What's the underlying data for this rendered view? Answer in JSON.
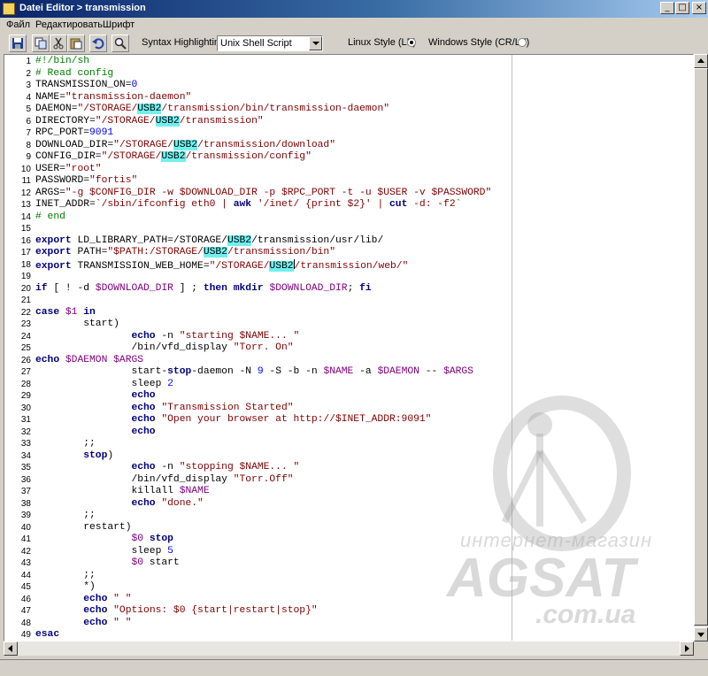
{
  "window": {
    "title": "Datei Editor > transmission",
    "minimize": "_",
    "maximize": "□",
    "close": "×"
  },
  "menu": {
    "items": [
      "Файл",
      "Редактировать",
      "Шрифт"
    ]
  },
  "toolbar": {
    "syntax_label": "Syntax Highlighting:",
    "syntax_value": "Unix Shell Script",
    "linux_style": "Linux Style (LF)",
    "windows_style": "Windows Style (CR/LF)",
    "selected_line_ending": "Linux Style (LF)"
  },
  "colors": {
    "keyword": "#000080",
    "string": "#800000",
    "comment": "#008000",
    "variable": "#800080",
    "number": "#0000ff",
    "highlight": "#6ff0f0"
  },
  "watermark": {
    "line1": "интернет-магазин",
    "line2": "AGSAT",
    "line3": ".com.ua"
  },
  "code": [
    {
      "n": "1",
      "t": [
        [
          "c",
          "#!/bin/sh"
        ]
      ]
    },
    {
      "n": "2",
      "t": [
        [
          "c",
          "# Read config"
        ]
      ]
    },
    {
      "n": "3",
      "t": [
        [
          "p",
          "TRANSMISSION_ON="
        ],
        [
          "n",
          "0"
        ]
      ]
    },
    {
      "n": "4",
      "t": [
        [
          "p",
          "NAME="
        ],
        [
          "s",
          "\"transmission-daemon\""
        ]
      ]
    },
    {
      "n": "5",
      "t": [
        [
          "p",
          "DAEMON="
        ],
        [
          "s",
          "\"/STORAGE/"
        ],
        [
          "h",
          "USB2"
        ],
        [
          "s",
          "/transmission/bin/transmission-daemon\""
        ]
      ]
    },
    {
      "n": "6",
      "t": [
        [
          "p",
          "DIRECTORY="
        ],
        [
          "s",
          "\"/STORAGE/"
        ],
        [
          "h",
          "USB2"
        ],
        [
          "s",
          "/transmission\""
        ]
      ]
    },
    {
      "n": "7",
      "t": [
        [
          "p",
          "RPC_PORT="
        ],
        [
          "n",
          "9091"
        ]
      ]
    },
    {
      "n": "8",
      "t": [
        [
          "p",
          "DOWNLOAD_DIR="
        ],
        [
          "s",
          "\"/STORAGE/"
        ],
        [
          "h",
          "USB2"
        ],
        [
          "s",
          "/transmission/download\""
        ]
      ]
    },
    {
      "n": "9",
      "t": [
        [
          "p",
          "CONFIG_DIR="
        ],
        [
          "s",
          "\"/STORAGE/"
        ],
        [
          "h",
          "USB2"
        ],
        [
          "s",
          "/transmission/config\""
        ]
      ]
    },
    {
      "n": "10",
      "t": [
        [
          "p",
          "USER="
        ],
        [
          "s",
          "\"root\""
        ]
      ]
    },
    {
      "n": "11",
      "t": [
        [
          "p",
          "PASSWORD="
        ],
        [
          "s",
          "\"fortis\""
        ]
      ]
    },
    {
      "n": "12",
      "t": [
        [
          "p",
          "ARGS="
        ],
        [
          "s",
          "\"-g $CONFIG_DIR -w $DOWNLOAD_DIR -p $RPC_PORT -t -u $USER -v $PASSWORD\""
        ]
      ]
    },
    {
      "n": "13",
      "t": [
        [
          "p",
          "INET_ADDR="
        ],
        [
          "s",
          "`/sbin/ifconfig eth0 | "
        ],
        [
          "k",
          "awk"
        ],
        [
          "s",
          " '/inet/ {print $2}' | "
        ],
        [
          "k",
          "cut"
        ],
        [
          "s",
          " -d: -f2`"
        ]
      ]
    },
    {
      "n": "14",
      "t": [
        [
          "c",
          "# end"
        ]
      ]
    },
    {
      "n": "15",
      "t": []
    },
    {
      "n": "16",
      "t": [
        [
          "k",
          "export"
        ],
        [
          "p",
          " LD_LIBRARY_PATH=/STORAGE/"
        ],
        [
          "h",
          "USB2"
        ],
        [
          "p",
          "/transmission/usr/lib/"
        ]
      ]
    },
    {
      "n": "17",
      "t": [
        [
          "k",
          "export"
        ],
        [
          "p",
          " PATH="
        ],
        [
          "s",
          "\"$PATH:/STORAGE/"
        ],
        [
          "h",
          "USB2"
        ],
        [
          "s",
          "/transmission/bin\""
        ]
      ]
    },
    {
      "n": "18",
      "t": [
        [
          "k",
          "export"
        ],
        [
          "p",
          " TRANSMISSION_WEB_HOME="
        ],
        [
          "s",
          "\"/STORAGE/"
        ],
        [
          "h",
          "USB2"
        ],
        [
          "cur",
          ""
        ],
        [
          "s",
          "/transmission/web/\""
        ]
      ]
    },
    {
      "n": "19",
      "t": []
    },
    {
      "n": "20",
      "t": [
        [
          "k",
          "if"
        ],
        [
          "p",
          " [ ! -d "
        ],
        [
          "v",
          "$DOWNLOAD_DIR"
        ],
        [
          "p",
          " ] ; "
        ],
        [
          "k",
          "then"
        ],
        [
          "p",
          " "
        ],
        [
          "k",
          "mkdir"
        ],
        [
          "p",
          " "
        ],
        [
          "v",
          "$DOWNLOAD_DIR"
        ],
        [
          "p",
          "; "
        ],
        [
          "k",
          "fi"
        ]
      ]
    },
    {
      "n": "21",
      "t": []
    },
    {
      "n": "22",
      "t": [
        [
          "k",
          "case"
        ],
        [
          "p",
          " "
        ],
        [
          "v",
          "$1"
        ],
        [
          "p",
          " "
        ],
        [
          "k",
          "in"
        ]
      ]
    },
    {
      "n": "23",
      "t": [
        [
          "p",
          "        start)"
        ]
      ]
    },
    {
      "n": "24",
      "t": [
        [
          "p",
          "                "
        ],
        [
          "k",
          "echo"
        ],
        [
          "p",
          " -n "
        ],
        [
          "s",
          "\"starting $NAME... \""
        ]
      ]
    },
    {
      "n": "25",
      "t": [
        [
          "p",
          "                /bin/vfd_display "
        ],
        [
          "s",
          "\"Torr. On\""
        ]
      ]
    },
    {
      "n": "26",
      "t": [
        [
          "k",
          "echo"
        ],
        [
          "p",
          " "
        ],
        [
          "v",
          "$DAEMON"
        ],
        [
          "p",
          " "
        ],
        [
          "v",
          "$ARGS"
        ]
      ]
    },
    {
      "n": "27",
      "t": [
        [
          "p",
          "                start-"
        ],
        [
          "k",
          "stop"
        ],
        [
          "p",
          "-daemon -N "
        ],
        [
          "n",
          "9"
        ],
        [
          "p",
          " -S -b -n "
        ],
        [
          "v",
          "$NAME"
        ],
        [
          "p",
          " -a "
        ],
        [
          "v",
          "$DAEMON"
        ],
        [
          "p",
          " -- "
        ],
        [
          "v",
          "$ARGS"
        ]
      ]
    },
    {
      "n": "28",
      "t": [
        [
          "p",
          "                sleep "
        ],
        [
          "n",
          "2"
        ]
      ]
    },
    {
      "n": "29",
      "t": [
        [
          "p",
          "                "
        ],
        [
          "k",
          "echo"
        ]
      ]
    },
    {
      "n": "30",
      "t": [
        [
          "p",
          "                "
        ],
        [
          "k",
          "echo"
        ],
        [
          "p",
          " "
        ],
        [
          "s",
          "\"Transmission Started\""
        ]
      ]
    },
    {
      "n": "31",
      "t": [
        [
          "p",
          "                "
        ],
        [
          "k",
          "echo"
        ],
        [
          "p",
          " "
        ],
        [
          "s",
          "\"Open your browser at http://$INET_ADDR:9091\""
        ]
      ]
    },
    {
      "n": "32",
      "t": [
        [
          "p",
          "                "
        ],
        [
          "k",
          "echo"
        ]
      ]
    },
    {
      "n": "33",
      "t": [
        [
          "p",
          "        ;;"
        ]
      ]
    },
    {
      "n": "34",
      "t": [
        [
          "p",
          "        "
        ],
        [
          "k",
          "stop"
        ],
        [
          "p",
          ")"
        ]
      ]
    },
    {
      "n": "35",
      "t": [
        [
          "p",
          "                "
        ],
        [
          "k",
          "echo"
        ],
        [
          "p",
          " -n "
        ],
        [
          "s",
          "\"stopping $NAME... \""
        ]
      ]
    },
    {
      "n": "36",
      "t": [
        [
          "p",
          "                /bin/vfd_display "
        ],
        [
          "s",
          "\"Torr.Off\""
        ]
      ]
    },
    {
      "n": "37",
      "t": [
        [
          "p",
          "                killall "
        ],
        [
          "v",
          "$NAME"
        ]
      ]
    },
    {
      "n": "38",
      "t": [
        [
          "p",
          "                "
        ],
        [
          "k",
          "echo"
        ],
        [
          "p",
          " "
        ],
        [
          "s",
          "\"done.\""
        ]
      ]
    },
    {
      "n": "39",
      "t": [
        [
          "p",
          "        ;;"
        ]
      ]
    },
    {
      "n": "40",
      "t": [
        [
          "p",
          "        restart)"
        ]
      ]
    },
    {
      "n": "41",
      "t": [
        [
          "p",
          "                "
        ],
        [
          "v",
          "$0"
        ],
        [
          "p",
          " "
        ],
        [
          "k",
          "stop"
        ]
      ]
    },
    {
      "n": "42",
      "t": [
        [
          "p",
          "                sleep "
        ],
        [
          "n",
          "5"
        ]
      ]
    },
    {
      "n": "43",
      "t": [
        [
          "p",
          "                "
        ],
        [
          "v",
          "$0"
        ],
        [
          "p",
          " start"
        ]
      ]
    },
    {
      "n": "44",
      "t": [
        [
          "p",
          "        ;;"
        ]
      ]
    },
    {
      "n": "45",
      "t": [
        [
          "p",
          "        *)"
        ]
      ]
    },
    {
      "n": "46",
      "t": [
        [
          "p",
          "        "
        ],
        [
          "k",
          "echo"
        ],
        [
          "p",
          " "
        ],
        [
          "s",
          "\" \""
        ]
      ]
    },
    {
      "n": "47",
      "t": [
        [
          "p",
          "        "
        ],
        [
          "k",
          "echo"
        ],
        [
          "p",
          " "
        ],
        [
          "s",
          "\"Options: $0 {start|restart|stop}\""
        ]
      ]
    },
    {
      "n": "48",
      "t": [
        [
          "p",
          "        "
        ],
        [
          "k",
          "echo"
        ],
        [
          "p",
          " "
        ],
        [
          "s",
          "\" \""
        ]
      ]
    },
    {
      "n": "49",
      "t": [
        [
          "k",
          "esac"
        ]
      ]
    }
  ]
}
